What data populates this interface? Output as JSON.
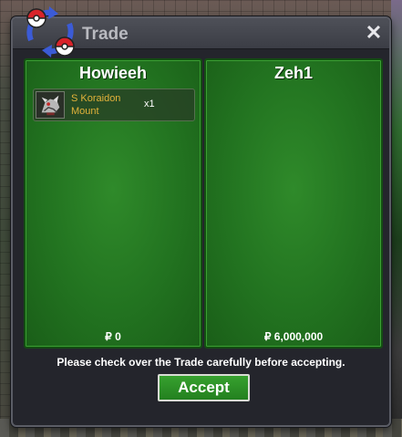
{
  "window": {
    "title": "Trade",
    "close_label": "✕"
  },
  "panels": [
    {
      "player": "Howieeh",
      "items": [
        {
          "name": "S Koraidon Mount",
          "qty": "x1",
          "icon": "koraidon-mount-icon"
        }
      ],
      "money": "₽ 0"
    },
    {
      "player": "Zeh1",
      "items": [],
      "money": "₽ 6,000,000"
    }
  ],
  "notice": "Please check over the Trade carefully before accepting.",
  "accept_label": "Accept",
  "colors": {
    "panel_green": "#227320",
    "item_name": "#e2b23a",
    "window_bg": "#24252c"
  }
}
